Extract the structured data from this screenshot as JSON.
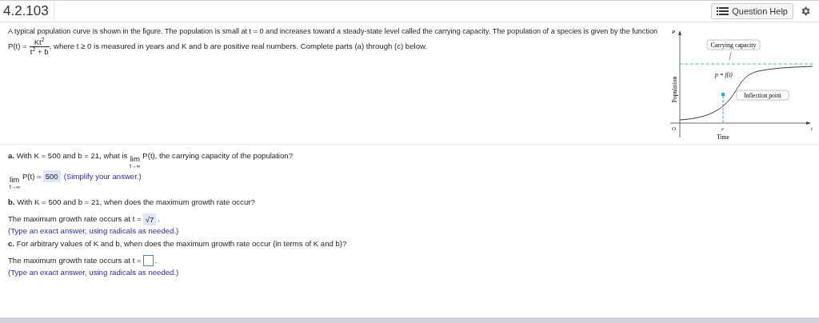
{
  "header": {
    "title": "4.2.103",
    "help_button": "Question Help"
  },
  "intro": "A typical population curve is shown in the figure. The population is small at t = 0 and increases toward a steady-state level called the carrying capacity. The population of a species is given by the function",
  "formula": {
    "lhs": "P(t) =",
    "numerator": "Kt$^{2}$",
    "denominator": "t$^{2}$ + b",
    "rest": ", where t ≥ 0 is measured in years and K and b are positive real numbers. Complete parts (a) through (c) below."
  },
  "figure": {
    "y_axis": "P",
    "x_axis": "t",
    "origin": "O",
    "c_mark": "c",
    "x_title": "Time",
    "y_title": "Population",
    "carrying_label": "Carrying capacity",
    "curve_label": "p = f(t)",
    "inflection_label": "Inflection point"
  },
  "parts": [
    {
      "kind": "limit",
      "question_before": "**a.** With K = 500 and b = 21, what is",
      "limit_word": "lim",
      "limit_sub": "t→∞",
      "question_after": "P(t), the carrying capacity of the population?",
      "answer_lim": "lim",
      "answer_sub": "t→∞",
      "answer_label": "P(t) =",
      "answer": "500",
      "hint": "(Simplify your answer.)"
    },
    {
      "kind": "plain",
      "question": "**b.** With K = 500 and b = 21, when does the maximum growth rate occur?",
      "answer_label": "The maximum growth rate occurs at t =",
      "answer": "√7",
      "answer_end": ".",
      "hint": "(Type an exact answer, using radicals as needed.)"
    },
    {
      "kind": "plain",
      "question": "**c.** For arbitrary values of K and b, when does the maximum growth rate occur (in terms of K and b)?",
      "answer_label": "The maximum growth rate occurs at t =",
      "answer_end": ".",
      "hint": "(Type an exact answer, using radicals as needed.)"
    }
  ]
}
